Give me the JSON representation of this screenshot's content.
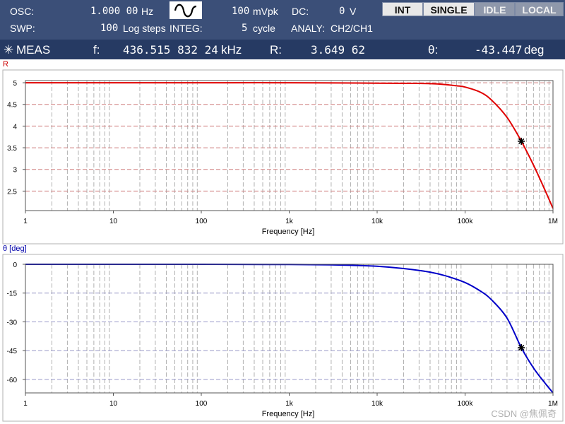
{
  "header": {
    "osc_label": "OSC:",
    "osc_value": "1.000 00",
    "osc_unit": "Hz",
    "amp_value": "100",
    "amp_unit": "mVpk",
    "dc_label": "DC:",
    "dc_value": "0",
    "dc_unit": "V",
    "swp_label": "SWP:",
    "swp_value": "100",
    "swp_unit": "Log steps",
    "integ_label": "INTEG:",
    "integ_value": "5",
    "integ_unit": "cycle",
    "analy_label": "ANALY:",
    "analy_value": "CH2/CH1",
    "buttons": [
      "INT",
      "SINGLE",
      "IDLE",
      "LOCAL"
    ]
  },
  "meas": {
    "icon": "asterisk-icon",
    "label": "MEAS",
    "f_label": "f:",
    "f_value": "436.515 832 24",
    "f_unit": "kHz",
    "r_label": "R:",
    "r_value": "3.649 62",
    "theta_label": "θ:",
    "theta_value": "-43.447",
    "theta_unit": "deg"
  },
  "plots": {
    "r_label": "R",
    "theta_label": "θ [deg]",
    "x_ticklabels": [
      "1",
      "10",
      "100",
      "1k",
      "10k",
      "100k",
      "1M"
    ],
    "x_label": "Frequency [Hz]"
  },
  "chart_data": [
    {
      "type": "line",
      "title": "R",
      "xlabel": "Frequency [Hz]",
      "ylabel": "R",
      "xscale": "log",
      "xlim": [
        1,
        1000000
      ],
      "ylim": [
        2.05,
        5.05
      ],
      "yticks": [
        5,
        4.5,
        4,
        3.5,
        3,
        2.5
      ],
      "grid": true,
      "color": "#e00000",
      "x": [
        1,
        10,
        100,
        1000,
        10000,
        30000,
        50000,
        80000,
        100000,
        150000,
        200000,
        300000,
        436515.83224,
        600000,
        800000,
        1000000
      ],
      "y": [
        5.0,
        5.0,
        5.0,
        5.0,
        4.99,
        4.985,
        4.97,
        4.93,
        4.9,
        4.78,
        4.6,
        4.2,
        3.64962,
        3.1,
        2.55,
        2.1
      ],
      "marker": {
        "x": 436515.83224,
        "y": 3.64962
      }
    },
    {
      "type": "line",
      "title": "θ [deg]",
      "xlabel": "Frequency [Hz]",
      "ylabel": "θ [deg]",
      "xscale": "log",
      "xlim": [
        1,
        1000000
      ],
      "ylim": [
        -67,
        0
      ],
      "yticks": [
        0,
        -15,
        -30,
        -45,
        -60
      ],
      "grid": true,
      "color": "#0000c8",
      "x": [
        1,
        100,
        1000,
        3000,
        5000,
        10000,
        20000,
        40000,
        60000,
        100000,
        150000,
        200000,
        300000,
        436515.83224,
        600000,
        800000,
        1000000
      ],
      "y": [
        0,
        0,
        -0.1,
        -0.3,
        -0.5,
        -1.0,
        -2.2,
        -4.1,
        -6.0,
        -9.5,
        -14.0,
        -18.5,
        -28.0,
        -43.447,
        -54.0,
        -61.5,
        -67.0
      ],
      "marker": {
        "x": 436515.83224,
        "y": -43.447
      }
    }
  ]
}
